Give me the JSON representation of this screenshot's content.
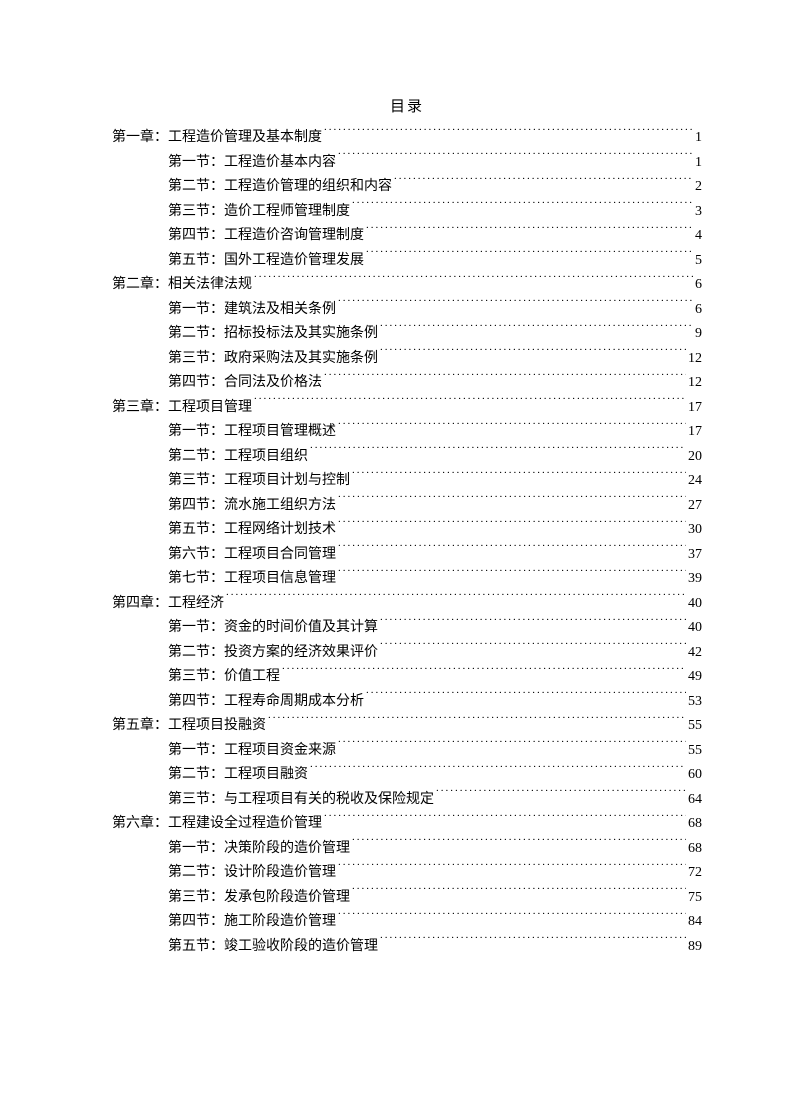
{
  "title": "目录",
  "entries": [
    {
      "level": 1,
      "label": "第一章：工程造价管理及基本制度",
      "page": "1"
    },
    {
      "level": 2,
      "label": "第一节：工程造价基本内容",
      "page": "1"
    },
    {
      "level": 2,
      "label": "第二节：工程造价管理的组织和内容",
      "page": "2"
    },
    {
      "level": 2,
      "label": "第三节：造价工程师管理制度",
      "page": "3"
    },
    {
      "level": 2,
      "label": "第四节：工程造价咨询管理制度",
      "page": "4"
    },
    {
      "level": 2,
      "label": "第五节：国外工程造价管理发展",
      "page": "5"
    },
    {
      "level": 1,
      "label": "第二章：相关法律法规",
      "page": "6"
    },
    {
      "level": 2,
      "label": "第一节：建筑法及相关条例",
      "page": "6"
    },
    {
      "level": 2,
      "label": "第二节：招标投标法及其实施条例",
      "page": "9"
    },
    {
      "level": 2,
      "label": "第三节：政府采购法及其实施条例",
      "page": "12"
    },
    {
      "level": 2,
      "label": "第四节：合同法及价格法",
      "page": "12"
    },
    {
      "level": 1,
      "label": "第三章：工程项目管理",
      "page": "17"
    },
    {
      "level": 2,
      "label": "第一节：工程项目管理概述",
      "page": "17"
    },
    {
      "level": 2,
      "label": "第二节：工程项目组织",
      "page": "20"
    },
    {
      "level": 2,
      "label": "第三节：工程项目计划与控制",
      "page": "24"
    },
    {
      "level": 2,
      "label": "第四节：流水施工组织方法",
      "page": "27"
    },
    {
      "level": 2,
      "label": "第五节：工程网络计划技术",
      "page": "30"
    },
    {
      "level": 2,
      "label": "第六节：工程项目合同管理",
      "page": "37"
    },
    {
      "level": 2,
      "label": "第七节：工程项目信息管理",
      "page": "39"
    },
    {
      "level": 1,
      "label": "第四章：工程经济",
      "page": "40"
    },
    {
      "level": 2,
      "label": "第一节：资金的时间价值及其计算",
      "page": "40"
    },
    {
      "level": 2,
      "label": "第二节：投资方案的经济效果评价",
      "page": "42"
    },
    {
      "level": 2,
      "label": "第三节：价值工程",
      "page": "49"
    },
    {
      "level": 2,
      "label": "第四节：工程寿命周期成本分析",
      "page": "53"
    },
    {
      "level": 1,
      "label": "第五章：工程项目投融资",
      "page": "55"
    },
    {
      "level": 2,
      "label": "第一节：工程项目资金来源",
      "page": "55"
    },
    {
      "level": 2,
      "label": "第二节：工程项目融资",
      "page": "60"
    },
    {
      "level": 2,
      "label": "第三节：与工程项目有关的税收及保险规定",
      "page": "64"
    },
    {
      "level": 1,
      "label": "第六章：工程建设全过程造价管理",
      "page": "68"
    },
    {
      "level": 2,
      "label": "第一节：决策阶段的造价管理",
      "page": "68"
    },
    {
      "level": 2,
      "label": "第二节：设计阶段造价管理",
      "page": "72"
    },
    {
      "level": 2,
      "label": "第三节：发承包阶段造价管理",
      "page": "75"
    },
    {
      "level": 2,
      "label": "第四节：施工阶段造价管理",
      "page": "84"
    },
    {
      "level": 2,
      "label": "第五节：竣工验收阶段的造价管理",
      "page": "89"
    }
  ]
}
